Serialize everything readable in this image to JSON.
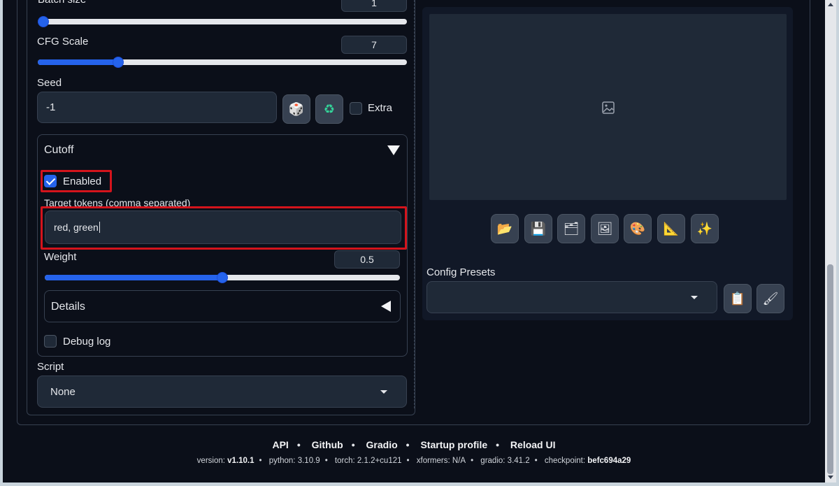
{
  "batch_size": {
    "label": "Batch size",
    "value": "1"
  },
  "cfg_scale": {
    "label": "CFG Scale",
    "value": "7",
    "level": 0.2
  },
  "seed": {
    "label": "Seed",
    "value": "-1",
    "dice_icon": "🎲",
    "recycle_icon": "♻",
    "extra_label": "Extra"
  },
  "cutoff": {
    "title": "Cutoff",
    "enabled_label": "Enabled",
    "enabled": true,
    "tokens_label": "Target tokens (comma separated)",
    "tokens_value": "red, green",
    "weight_label": "Weight",
    "weight_value": "0.5",
    "weight_level": 0.5,
    "details_title": "Details",
    "debug_label": "Debug log"
  },
  "script": {
    "label": "Script",
    "value": "None"
  },
  "output_tools": {
    "icons": [
      "📂",
      "💾",
      "🗂",
      "🖼",
      "🎨",
      "📐",
      "✨"
    ]
  },
  "config_presets": {
    "label": "Config Presets",
    "value": "",
    "clipboard_icon": "📋",
    "brush_icon": "🖌"
  },
  "footer": {
    "links": [
      "API",
      "Github",
      "Gradio",
      "Startup profile",
      "Reload UI"
    ],
    "version_label": "version:",
    "version": "v1.10.1",
    "python_label": "python:",
    "python": "3.10.9",
    "torch_label": "torch:",
    "torch": "2.1.2+cu121",
    "xformers_label": "xformers:",
    "xformers": "N/A",
    "gradio_label": "gradio:",
    "gradio": "3.41.2",
    "checkpoint_label": "checkpoint:",
    "checkpoint": "befc694a29"
  },
  "colors": {
    "accent": "#2563eb",
    "highlight": "#d4141c",
    "background": "#0b0f19"
  }
}
